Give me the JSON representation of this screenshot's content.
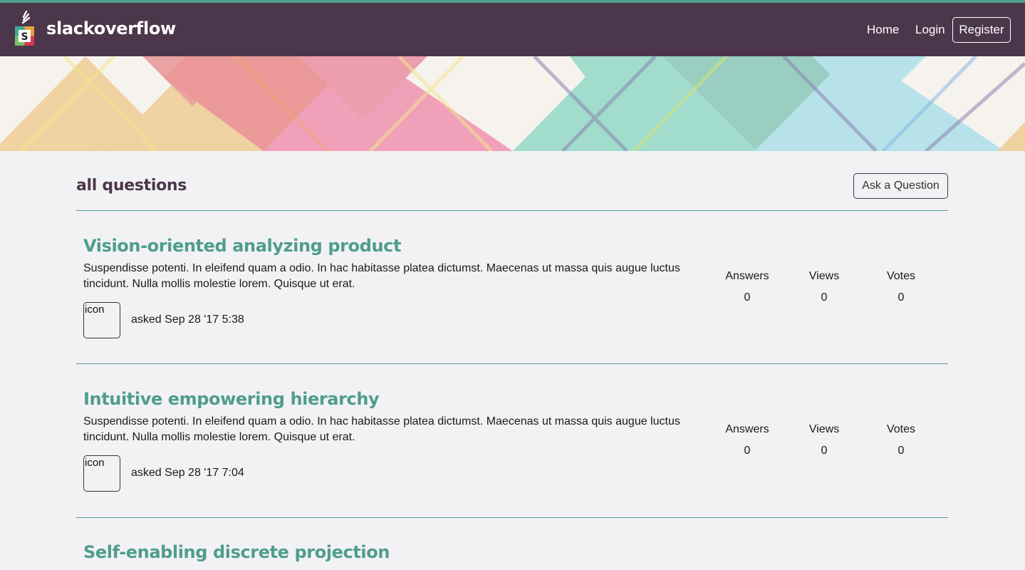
{
  "navbar": {
    "brand": "slackoverflow",
    "logo_letter": "S",
    "links": {
      "home": "Home",
      "login": "Login",
      "register": "Register"
    },
    "colors": {
      "bar": "#4c364b",
      "accent": "#4f9d8d"
    }
  },
  "main": {
    "title": "all questions",
    "ask_button": "Ask a Question"
  },
  "stat_labels": {
    "answers": "Answers",
    "views": "Views",
    "votes": "Votes"
  },
  "questions": [
    {
      "title": "Vision-oriented analyzing product",
      "body": "Suspendisse potenti. In eleifend quam a odio. In hac habitasse platea dictumst. Maecenas ut massa quis augue luctus tincidunt. Nulla mollis molestie lorem. Quisque ut erat.",
      "icon_alt": "icon",
      "asked": "asked Sep 28 '17 5:38",
      "answers": "0",
      "views": "0",
      "votes": "0"
    },
    {
      "title": "Intuitive empowering hierarchy",
      "body": "Suspendisse potenti. In eleifend quam a odio. In hac habitasse platea dictumst. Maecenas ut massa quis augue luctus tincidunt. Nulla mollis molestie lorem. Quisque ut erat.",
      "icon_alt": "icon",
      "asked": "asked Sep 28 '17 7:04",
      "answers": "0",
      "views": "0",
      "votes": "0"
    },
    {
      "title": "Self-enabling discrete projection"
    }
  ]
}
